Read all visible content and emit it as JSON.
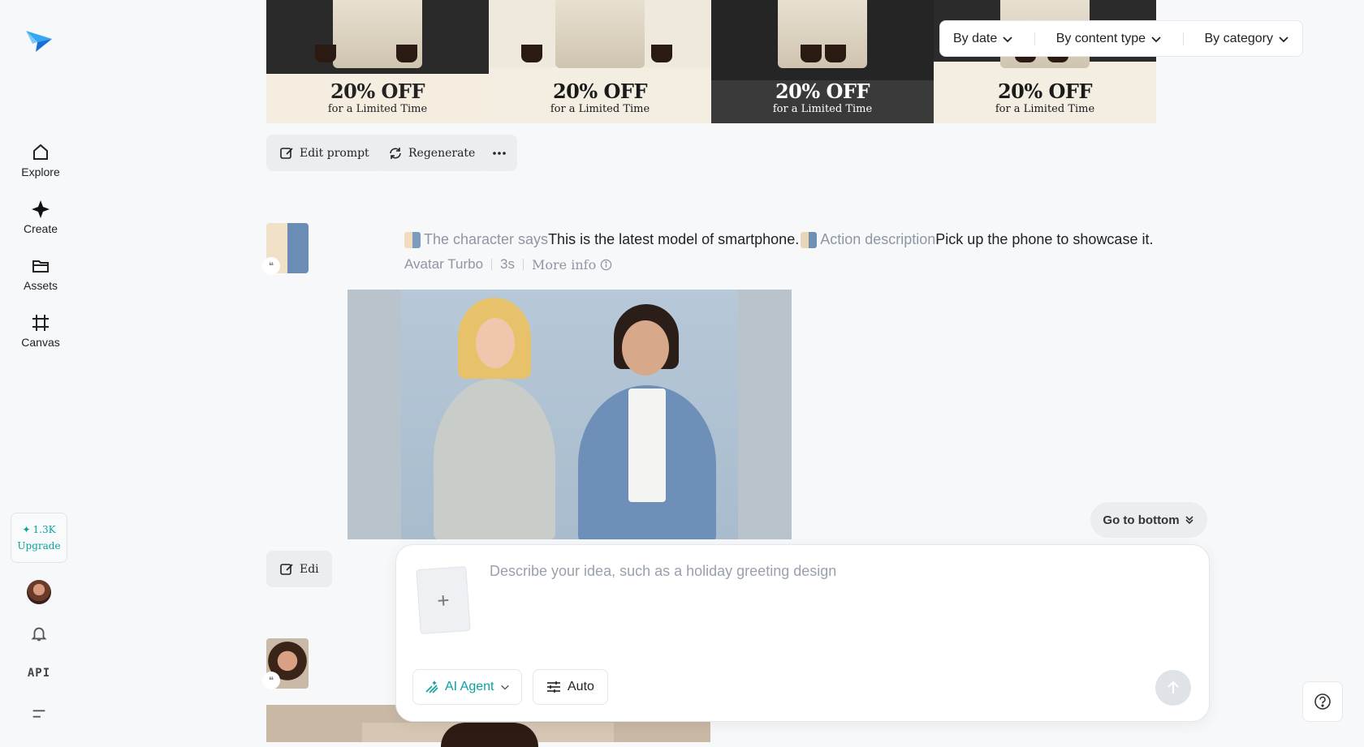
{
  "sidebar": {
    "logo": "paper-plane-logo",
    "items": [
      {
        "label": "Explore",
        "icon": "home-icon"
      },
      {
        "label": "Create",
        "icon": "sparkle-icon"
      },
      {
        "label": "Assets",
        "icon": "folder-icon"
      },
      {
        "label": "Canvas",
        "icon": "crop-frame-icon"
      }
    ],
    "credits": "1.3K",
    "upgrade_label": "Upgrade",
    "api_label": "API"
  },
  "filters": {
    "by_date": "By date",
    "by_content_type": "By content type",
    "by_category": "By category"
  },
  "banners": [
    {
      "big": "20% OFF",
      "small": "for a Limited Time"
    },
    {
      "big": "20% OFF",
      "small": "for a Limited Time"
    },
    {
      "big": "20% OFF",
      "small": "for a Limited Time"
    },
    {
      "big": "20% OFF",
      "small": "for a Limited Time"
    }
  ],
  "actions": {
    "edit_prompt": "Edit prompt",
    "regenerate": "Regenerate",
    "edit_partial": "Edi"
  },
  "entry": {
    "character_label": "The character says",
    "character_text": "This is the latest model of smartphone.",
    "action_label": "Action description",
    "action_text": "Pick up the phone to showcase it.",
    "model": "Avatar Turbo",
    "duration": "3s",
    "more_info": "More info"
  },
  "go_to_bottom": "Go to bottom",
  "composer": {
    "placeholder": "Describe your idea, such as a holiday greeting design",
    "value": "",
    "agent_label": "AI Agent",
    "auto_label": "Auto"
  },
  "colors": {
    "accent": "#0aa39e",
    "background": "#f7f8fa",
    "muted_text": "#8e96a3"
  }
}
